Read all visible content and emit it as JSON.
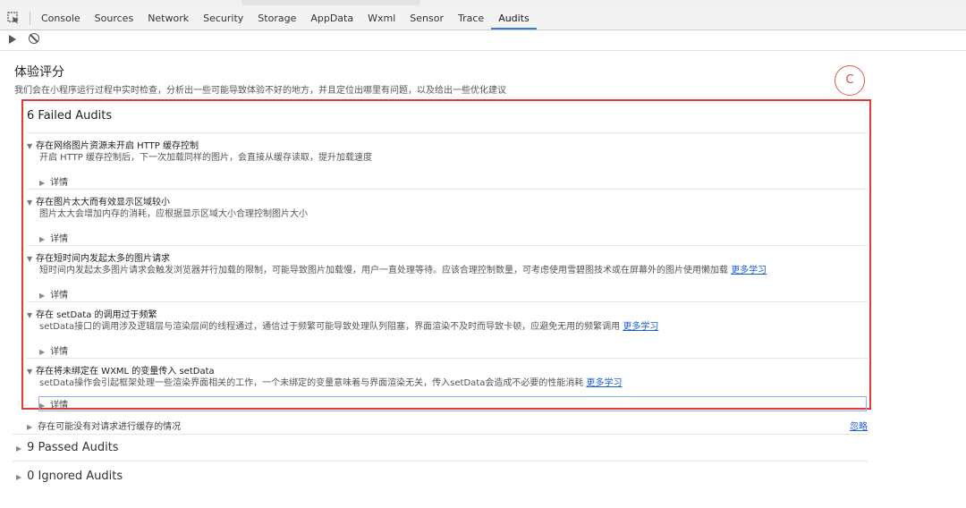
{
  "tabs": [
    {
      "label": "Console"
    },
    {
      "label": "Sources"
    },
    {
      "label": "Network"
    },
    {
      "label": "Security"
    },
    {
      "label": "Storage"
    },
    {
      "label": "AppData"
    },
    {
      "label": "Wxml"
    },
    {
      "label": "Sensor"
    },
    {
      "label": "Trace"
    },
    {
      "label": "Audits"
    }
  ],
  "active_tab": "Audits",
  "header": {
    "title": "体验评分",
    "subtitle": "我们会在小程序运行过程中实时检查，分析出一些可能导致体验不好的地方，并且定位出哪里有问题，以及给出一些优化建议",
    "grade": "C"
  },
  "failed": {
    "title": "6 Failed Audits",
    "audits": [
      {
        "title": "存在网络图片资源未开启 HTTP 缓存控制",
        "desc": "开启 HTTP 缓存控制后，下一次加载同样的图片，会直接从缓存读取，提升加载速度",
        "link": "",
        "detail": "详情"
      },
      {
        "title": "存在图片太大而有效显示区域较小",
        "desc": "图片太大会增加内存的消耗，应根据显示区域大小合理控制图片大小",
        "link": "",
        "detail": "详情"
      },
      {
        "title": "存在短时间内发起太多的图片请求",
        "desc": "短时间内发起太多图片请求会触发浏览器并行加载的限制，可能导致图片加载慢，用户一直处理等待。应该合理控制数量，可考虑使用雪碧图技术或在屏幕外的图片使用懒加载",
        "link": "更多学习",
        "detail": "详情"
      },
      {
        "title": "存在 setData 的调用过于频繁",
        "desc": "setData接口的调用涉及逻辑层与渲染层间的线程通过，通信过于频繁可能导致处理队列阻塞，界面渲染不及时而导致卡顿，应避免无用的频繁调用",
        "link": "更多学习",
        "detail": "详情"
      },
      {
        "title": "存在将未绑定在 WXML 的变量传入 setData",
        "desc": "setData操作会引起框架处理一些渲染界面相关的工作，一个未绑定的变量意味着与界面渲染无关，传入setData会造成不必要的性能消耗",
        "link": "更多学习",
        "detail": "详情"
      }
    ],
    "collapsed_item": {
      "title": "存在可能没有对请求进行缓存的情况",
      "ignore": "忽略"
    }
  },
  "passed": {
    "title": "9 Passed Audits"
  },
  "ignored": {
    "title": "0 Ignored Audits"
  },
  "colors": {
    "highlight_border": "#e53935",
    "link": "#1a5fd6",
    "grade": "#e05a4a",
    "active_tab_underline": "#3879d9"
  }
}
